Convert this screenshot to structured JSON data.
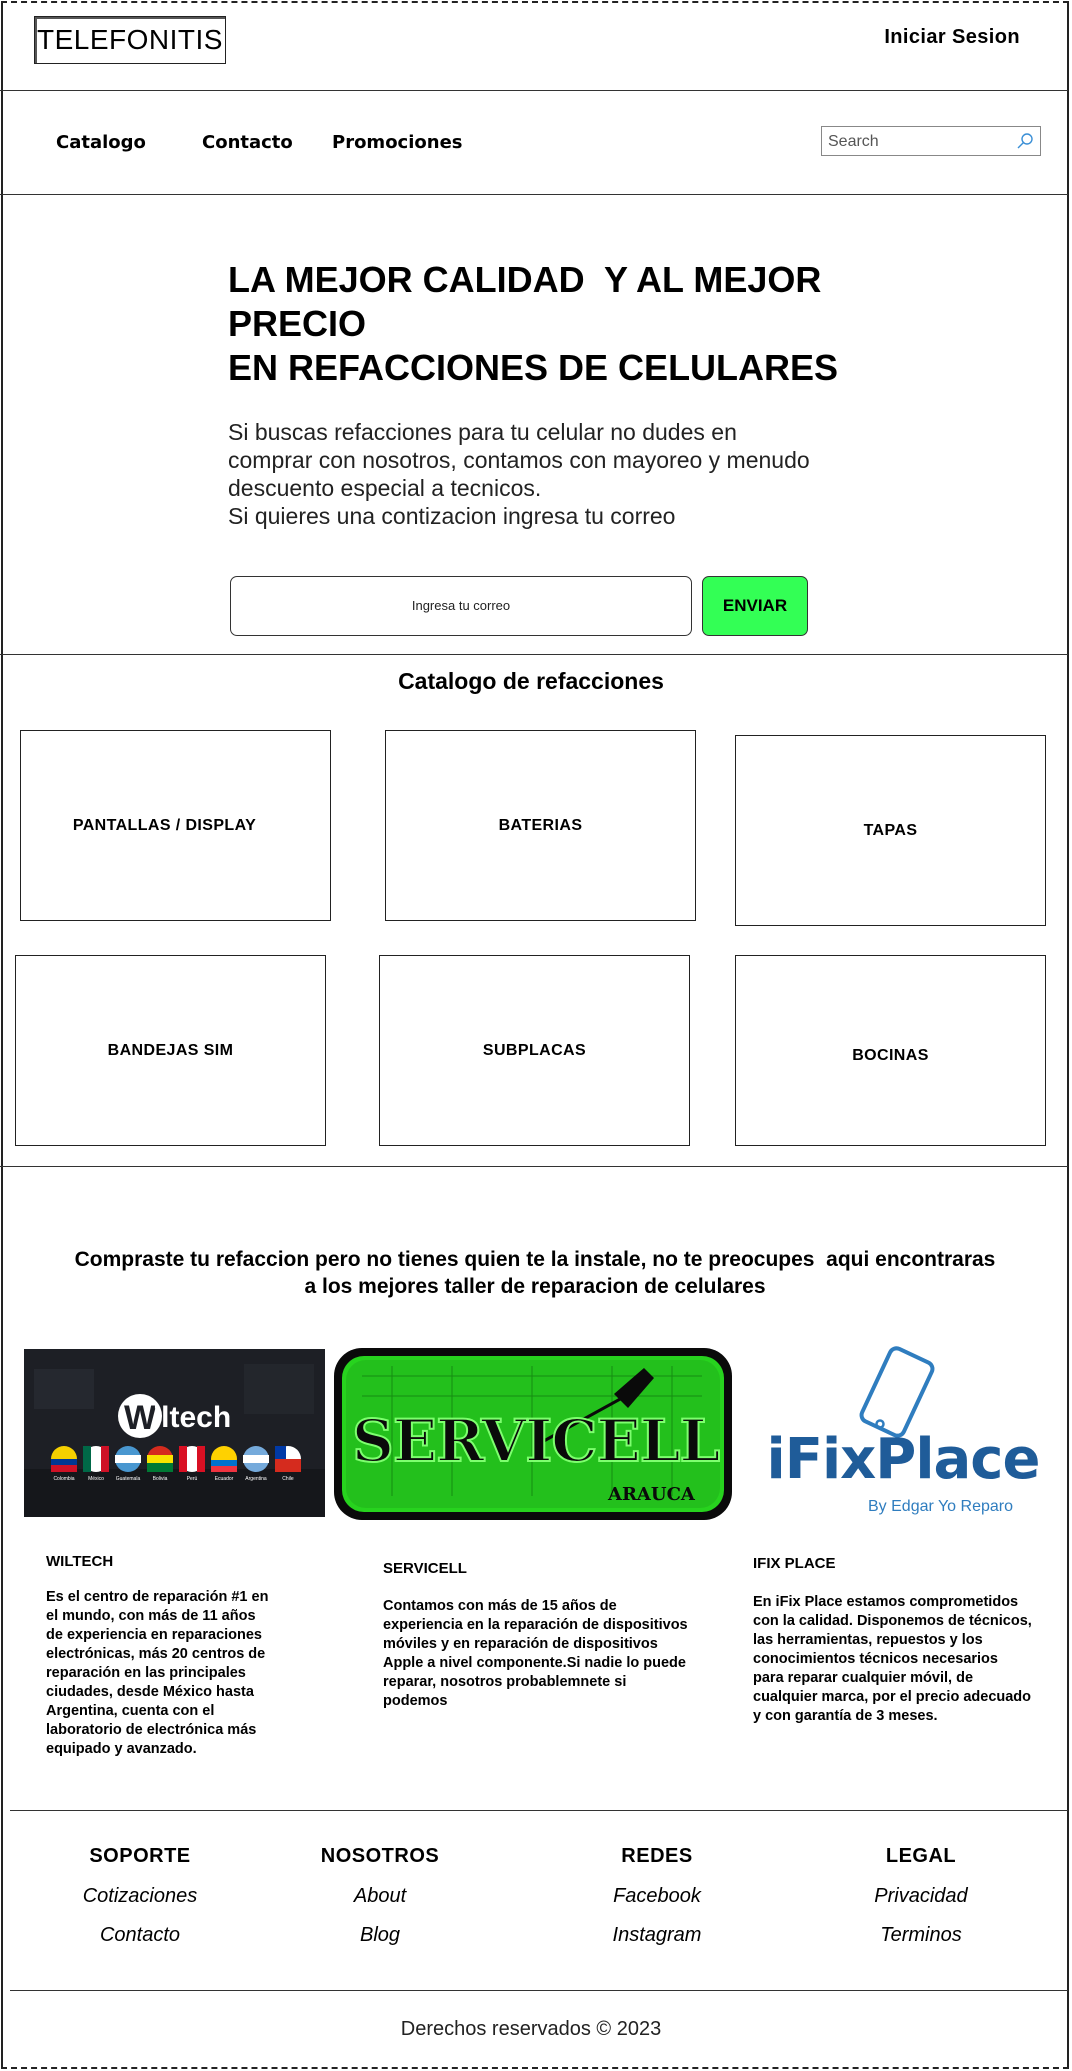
{
  "header": {
    "logo": "TELEFONITIS",
    "login_label": "Iniciar Sesion"
  },
  "nav": {
    "items": [
      "Catalogo",
      "Contacto",
      "Promociones"
    ],
    "search_placeholder": "Search"
  },
  "hero": {
    "title_lines": [
      "LA MEJOR CALIDAD  Y AL MEJOR",
      "PRECIO",
      "EN REFACCIONES DE CELULARES"
    ],
    "text_lines": [
      "Si buscas refacciones para tu celular no dudes en",
      "comprar con nosotros, contamos con mayoreo y menudo",
      "descuento especial a tecnicos.",
      "Si quieres una contizacion ingresa tu correo"
    ],
    "email_placeholder": "Ingresa tu correo",
    "send_label": "ENVIAR",
    "send_color": "#33ff55"
  },
  "catalog": {
    "title": "Catalogo de refacciones",
    "items": [
      "PANTALLAS / DISPLAY",
      "BATERIAS",
      "TAPAS",
      "BANDEJAS SIM",
      "SUBPLACAS",
      "BOCINAS"
    ]
  },
  "workshops": {
    "title_lines": [
      "Compraste tu refaccion pero no tienes quien te la instale, no te preocupes  aqui encontraras",
      "a los mejores taller de reparacion de celulares"
    ],
    "wiltech": {
      "logo_text": "Wiltech",
      "flag_labels": [
        "Colombia",
        "México",
        "Guatemala",
        "Bolivia",
        "Perú",
        "Ecuador",
        "Argentina",
        "Chile"
      ],
      "name": "WILTECH",
      "desc_lines": [
        "Es el centro de reparación #1 en",
        "el mundo, con más de 11 años",
        "de experiencia en reparaciones",
        "electrónicas, más 20 centros de",
        "reparación en las principales",
        "ciudades, desde México hasta",
        "Argentina, cuenta con el",
        "laboratorio de electrónica más",
        "equipado y avanzado."
      ]
    },
    "servicell": {
      "logo_text": "SERVICELL",
      "logo_sub": "ARAUCA",
      "name": "SERVICELL",
      "desc_lines": [
        "Contamos con más de 15 años de",
        "experiencia en la reparación de dispositivos",
        "móviles y en reparación de dispositivos",
        "Apple a nivel componente.Si nadie lo puede",
        "reparar, nosotros probablemnete si",
        "podemos"
      ]
    },
    "ifix": {
      "logo_text": "iFixPlace",
      "logo_sub": "By Edgar Yo Reparo",
      "name": "IFIX PLACE",
      "desc_lines": [
        "En iFix Place estamos comprometidos",
        "con la calidad. Disponemos de técnicos,",
        "las herramientas, repuestos y los",
        "conocimientos técnicos necesarios",
        "para reparar cualquier móvil, de",
        "cualquier marca, por el precio adecuado",
        "y con garantía de 3 meses."
      ]
    }
  },
  "footer": {
    "columns": [
      {
        "heading": "SOPORTE",
        "links": [
          "Cotizaciones",
          "Contacto"
        ]
      },
      {
        "heading": "NOSOTROS",
        "links": [
          "About",
          "Blog"
        ]
      },
      {
        "heading": "REDES",
        "links": [
          "Facebook",
          "Instagram"
        ]
      },
      {
        "heading": "LEGAL",
        "links": [
          "Privacidad",
          "Terminos"
        ]
      }
    ],
    "copyright": "Derechos reservados © 2023"
  }
}
